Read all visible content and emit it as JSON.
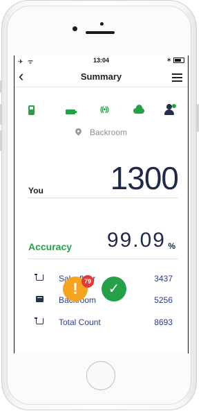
{
  "status": {
    "left": "✈ ᯤ",
    "time": "13:04",
    "bluetooth": "∗"
  },
  "nav": {
    "back_icon": "‹",
    "title": "Summary",
    "menu_icon": "menu-icon"
  },
  "device_icons": [
    "scanner-icon",
    "battery-icon",
    "signal-icon",
    "cloud-icon",
    "user-icon"
  ],
  "location": {
    "label": "Backroom"
  },
  "you": {
    "label": "You",
    "value": "1300"
  },
  "accuracy": {
    "label": "Accuracy",
    "value": "99.09",
    "unit": "%"
  },
  "rows": [
    {
      "icon": "cart-icon",
      "label": "Salesfloor",
      "value": "3437"
    },
    {
      "icon": "box-icon",
      "label": "Backroom",
      "value": "5256"
    },
    {
      "icon": "cart-icon",
      "label": "Total Count",
      "value": "8693"
    }
  ],
  "actions": {
    "warn_glyph": "!",
    "warn_badge": "79",
    "ok_glyph": "✓"
  },
  "colors": {
    "green": "#23a243",
    "navy": "#1e2a4a",
    "orange": "#f5a41f",
    "red": "#e53935",
    "link": "#2b3c8c"
  }
}
